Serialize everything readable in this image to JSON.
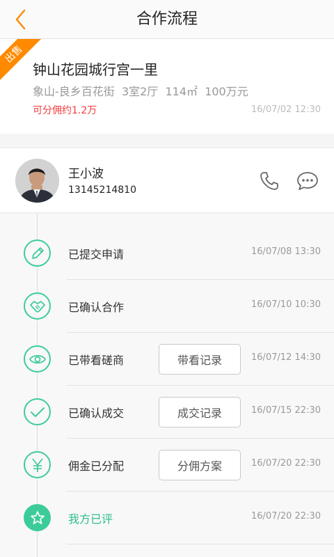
{
  "header": {
    "title": "合作流程",
    "back_icon": "chevron-left-icon",
    "accent": "#ff8a00"
  },
  "listing": {
    "badge": "出售",
    "title": "钟山花园城行宫一里",
    "detail": "象山-良乡百花街  3室2厅  114㎡  100万元",
    "commission": "可分佣约1.2万",
    "time": "16/07/02 12:30"
  },
  "agent": {
    "name": "王小波",
    "phone": "13145214810",
    "call_icon": "phone-icon",
    "message_icon": "chat-bubble-icon"
  },
  "timeline": {
    "accent": "#3ccc9a",
    "steps": [
      {
        "icon": "pencil-icon",
        "label": "已提交申请",
        "time": "16/07/08 13:30"
      },
      {
        "icon": "handshake-icon",
        "label": "已确认合作",
        "time": "16/07/10 10:30"
      },
      {
        "icon": "eye-icon",
        "label": "已带看磋商",
        "time": "16/07/12 14:30",
        "button": "带看记录"
      },
      {
        "icon": "checkmark-icon",
        "label": "已确认成交",
        "time": "16/07/15 22:30",
        "button": "成交记录"
      },
      {
        "icon": "yen-icon",
        "label": "佣金已分配",
        "time": "16/07/20 22:30",
        "button": "分佣方案"
      },
      {
        "icon": "star-icon",
        "label": "我方已评",
        "time": "16/07/20 22:30",
        "active": true
      }
    ]
  }
}
